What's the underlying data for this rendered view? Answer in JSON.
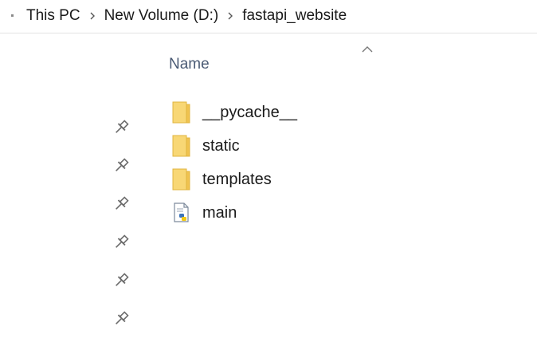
{
  "breadcrumb": {
    "items": [
      "This PC",
      "New Volume (D:)",
      "fastapi_website"
    ]
  },
  "columns": {
    "name_label": "Name"
  },
  "files": [
    {
      "name": "__pycache__",
      "type": "folder",
      "icon": "folder-icon"
    },
    {
      "name": "static",
      "type": "folder",
      "icon": "folder-icon"
    },
    {
      "name": "templates",
      "type": "folder",
      "icon": "folder-icon"
    },
    {
      "name": "main",
      "type": "python-file",
      "icon": "python-file-icon"
    }
  ],
  "quick_access_pins": 6,
  "colors": {
    "folder_fill": "#f8d775",
    "folder_edge": "#e0b440",
    "header_text": "#4a5a74",
    "separator": "#e3e3e3"
  }
}
